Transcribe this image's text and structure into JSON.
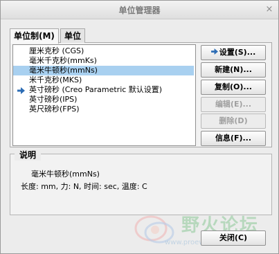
{
  "window": {
    "title": "单位管理器",
    "close_glyph": "×"
  },
  "tabs": [
    {
      "label": "单位制(M)",
      "active": true
    },
    {
      "label": "单位",
      "active": false
    }
  ],
  "systems": [
    {
      "label": "厘米克秒 (CGS)",
      "selected": false,
      "current": false
    },
    {
      "label": "毫米千克秒(mmKs)",
      "selected": false,
      "current": false
    },
    {
      "label": "毫米牛顿秒(mmNs)",
      "selected": true,
      "current": false
    },
    {
      "label": "米千克秒(MKS)",
      "selected": false,
      "current": false
    },
    {
      "label": "英寸磅秒 (Creo Parametric 默认设置)",
      "selected": false,
      "current": true
    },
    {
      "label": "英寸磅秒(IPS)",
      "selected": false,
      "current": false
    },
    {
      "label": "英尺磅秒(FPS)",
      "selected": false,
      "current": false
    }
  ],
  "buttons": {
    "set": "设置(S)...",
    "new": "新建(N)...",
    "copy": "复制(O)...",
    "edit": "编辑(E)...",
    "delete": "删除(D)",
    "info": "信息(F)..."
  },
  "description": {
    "legend": "说明",
    "name": "毫米牛顿秒(mmNs)",
    "detail": "长度: mm, 力: N, 时间: sec, 温度: C"
  },
  "close_button": "关闭(C)",
  "watermark": {
    "text": "野火论坛",
    "url": "www.proewildfire.cn"
  },
  "colors": {
    "selection": "#a8d0f0",
    "arrow": "#2d6db5"
  },
  "icons": {
    "current_marker": "arrow-right-icon",
    "set_button": "arrow-right-icon"
  }
}
